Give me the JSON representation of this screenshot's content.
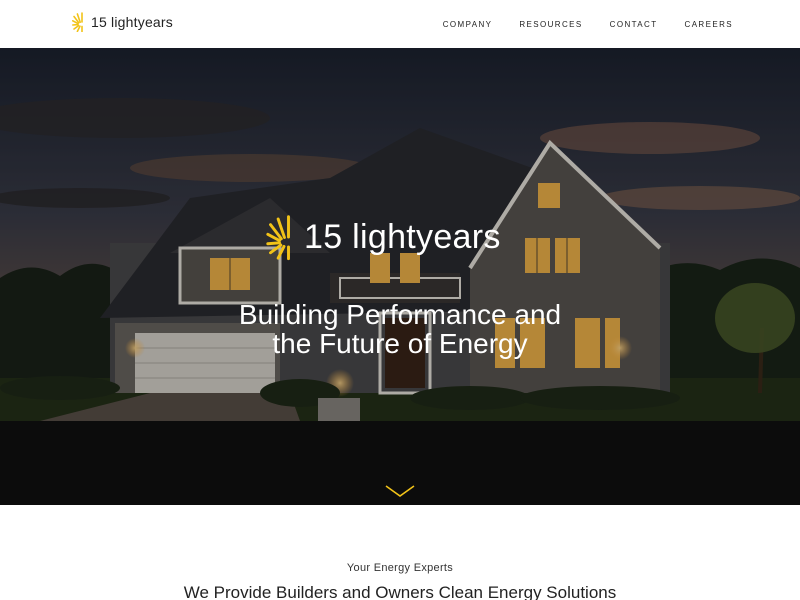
{
  "brand": {
    "name": "15 lightyears",
    "icon": "sun-rays-icon",
    "accent": "#f2c318"
  },
  "nav": {
    "items": [
      {
        "label": "COMPANY"
      },
      {
        "label": "RESOURCES"
      },
      {
        "label": "CONTACT"
      },
      {
        "label": "CAREERS"
      }
    ]
  },
  "hero": {
    "logo_text": "15 lightyears",
    "title_line1": "Building Performance and",
    "title_line2": "the Future of Energy",
    "image": "house-at-dusk-photo",
    "scroll_icon": "chevron-down-icon",
    "scroll_icon_color": "#f2c318"
  },
  "intro": {
    "eyebrow": "Your Energy Experts",
    "heading": "We Provide Builders and Owners Clean Energy Solutions"
  }
}
